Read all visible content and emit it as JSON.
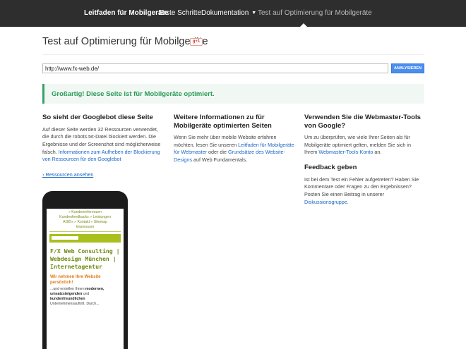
{
  "nav": {
    "brand": "Leitfaden für Mobilgeräte",
    "items": [
      "Erste Schritte",
      "Dokumentation",
      "Test auf Optimierung für Mobilgeräte"
    ]
  },
  "page": {
    "title": "Test auf Optimierung für Mobilgeräte",
    "gplus": "g+1"
  },
  "form": {
    "url_value": "http://www.fx-web.de/",
    "analyze_label": "ANALYSIEREN"
  },
  "result": {
    "message": "Großartig! Diese Seite ist für Mobilgeräte optimiert."
  },
  "col1": {
    "heading": "So sieht der Googlebot diese Seite",
    "text": "Auf dieser Seite werden 32 Ressourcen verwendet, die durch die robots.txt-Datei blockiert werden. Die Ergebnisse und der Screenshot sind möglicherweise falsch.",
    "link": "Informationen zum Aufheben der Blockierung von Ressourcen für den Googlebot",
    "resources_link": "› Ressourcen ansehen"
  },
  "col2": {
    "heading": "Weitere Informationen zu für Mobilgeräte optimierten Seiten",
    "text_a": "Wenn Sie mehr über mobile Website erfahren möchten, lesen Sie unseren",
    "link_a": "Leitfaden für Mobilgeräte für Webmaster",
    "text_b": "oder die",
    "link_b": "Grundsätze des Website-Designs",
    "text_c": "auf Web Fundamentals."
  },
  "col3": {
    "heading": "Verwenden Sie die Webmaster-Tools von Google?",
    "text": "Um zu überprüfen, wie viele Ihrer Seiten als für Mobilgeräte optimiert gelten, melden Sie sich in Ihrem",
    "link": "Webmaster-Tools-Konto",
    "text_end": "an.",
    "feedback_heading": "Feedback geben",
    "feedback_text": "Ist bei dem Test ein Fehler aufgetreten? Haben Sie Kommentare oder Fragen zu den Ergebnissen? Posten Sie einen Beitrag in unserer",
    "feedback_link": "Diskussionsgruppe",
    "feedback_end": "."
  },
  "phone": {
    "nav_lines": [
      "» Kundenreferenzen",
      "Kundenfeedbacks » Leistungen",
      "AGB's » Kontakt » Sitemap",
      "Impressum"
    ],
    "headline": "F/X Web Consulting | Webdesign München | Internetagentur",
    "sub": "Wir nehmen Ihre Website persönlich!",
    "body_a": "...und erstellen Ihnen",
    "body_b": "modernen, umsatzsteigenden",
    "body_c": "und",
    "body_d": "kundenfreundlichen",
    "body_e": "Unternehmensauftritt. Durch..."
  },
  "colors": {
    "accent": "#4a8ef0",
    "success": "#2a9a56",
    "nav_bg": "#2e2e2e",
    "mobile_green": "#a8bf1e"
  }
}
